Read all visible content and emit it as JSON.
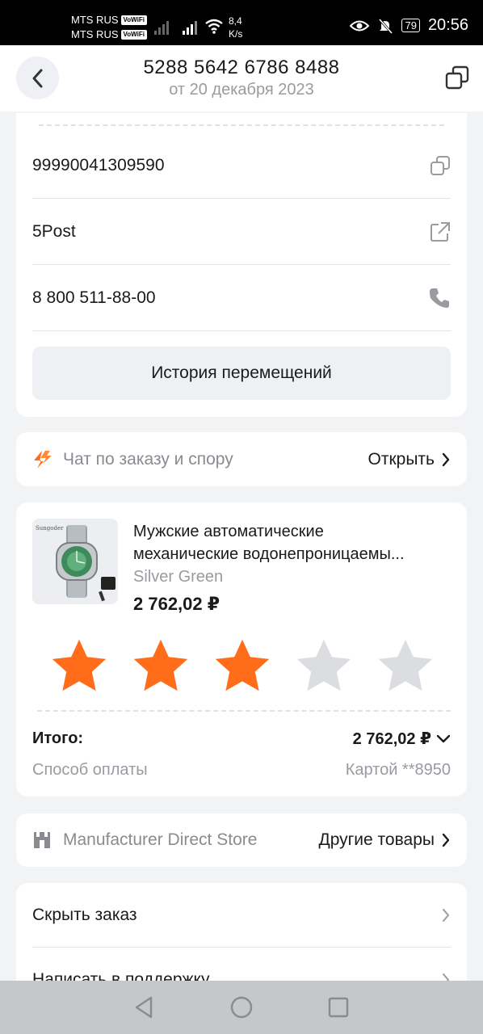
{
  "status_bar": {
    "carrier1": "MTS RUS",
    "carrier2": "MTS RUS",
    "vowifi": "VoWiFi",
    "net_speed_value": "8,4",
    "net_speed_unit": "K/s",
    "battery": "79",
    "time": "20:56"
  },
  "header": {
    "order_number": "5288 5642 6786 8488",
    "order_date": "от 20 декабря 2023"
  },
  "tracking": {
    "tracking_number": "99990041309590",
    "carrier": "5Post",
    "phone": "8 800 511-88-00",
    "history_button": "История перемещений"
  },
  "chat": {
    "label": "Чат по заказу и спору",
    "action": "Открыть"
  },
  "product": {
    "title_line1": "Мужские автоматические",
    "title_line2": "механические водонепроницаемы...",
    "variant": "Silver Green",
    "price": "2 762,02 ₽",
    "rating": 3,
    "rating_max": 5,
    "star_active_color": "#ff6d1a",
    "star_inactive_color": "#dcdde0"
  },
  "summary": {
    "total_label": "Итого:",
    "total_value": "2 762,02 ₽",
    "payment_label": "Способ оплаты",
    "payment_value": "Картой **8950"
  },
  "store": {
    "name": "Manufacturer Direct Store",
    "action": "Другие товары"
  },
  "menu": {
    "items": [
      {
        "label": "Скрыть заказ"
      },
      {
        "label": "Написать в поддержку"
      }
    ]
  }
}
